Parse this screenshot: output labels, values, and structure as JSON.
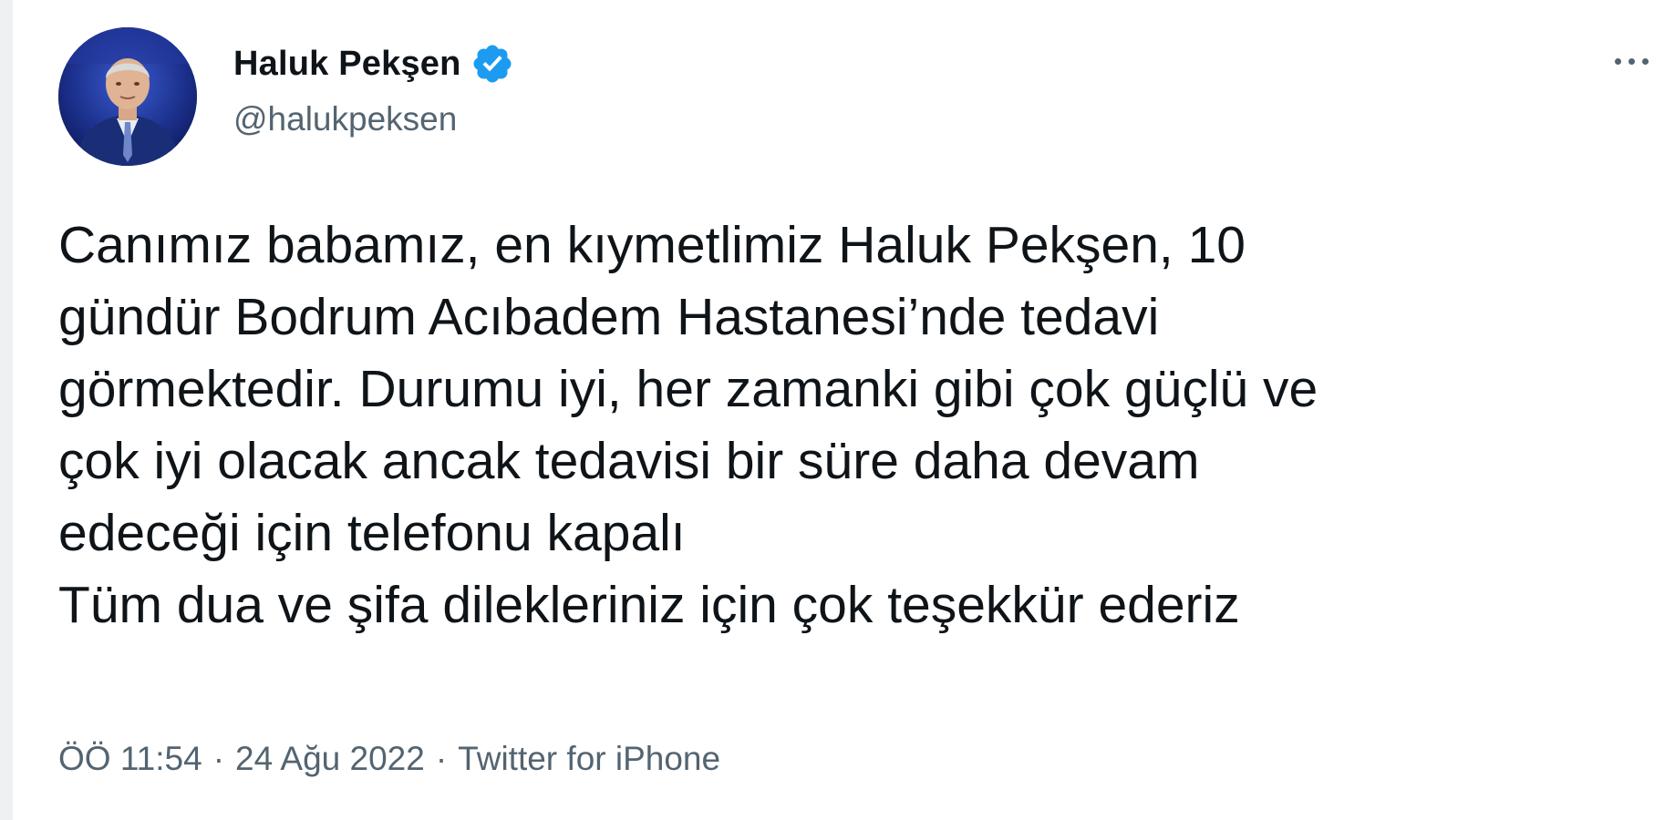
{
  "author": {
    "display_name": "Haluk Pekşen",
    "handle": "@halukpeksen",
    "verified_icon": "verified-badge-icon",
    "avatar": "profile-photo"
  },
  "menu": {
    "icon": "more-options-icon"
  },
  "tweet": {
    "text": "Canımız babamız, en kıymetlimiz Haluk Pekşen, 10\ngündür Bodrum Acıbadem Hastanesi’nde tedavi\ngörmektedir. Durumu iyi, her zamanki gibi çok güçlü ve\nçok iyi olacak ancak tedavisi bir süre daha devam\nedeceği için telefonu kapalı\nTüm dua ve şifa dilekleriniz için çok teşekkür ederiz"
  },
  "meta": {
    "time": "ÖÖ 11:54",
    "separator": "·",
    "date": "24 Ağu 2022",
    "source": "Twitter for iPhone"
  },
  "colors": {
    "text": "#0f1419",
    "secondary": "#536471",
    "verified": "#1d9bf0"
  }
}
